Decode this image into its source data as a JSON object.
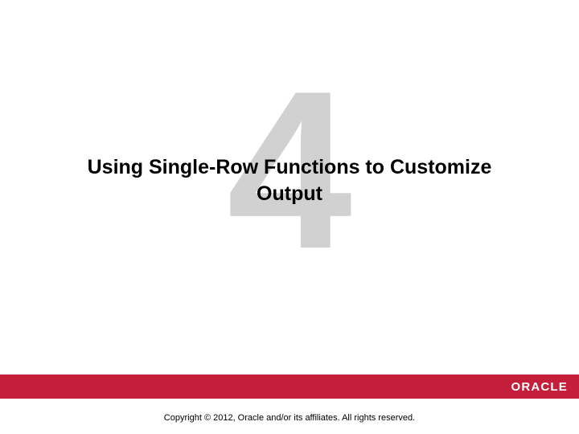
{
  "chapter_number": "4",
  "title": "Using Single-Row Functions to Customize Output",
  "logo_text": "ORACLE",
  "copyright": "Copyright © 2012, Oracle and/or its affiliates. All rights reserved."
}
